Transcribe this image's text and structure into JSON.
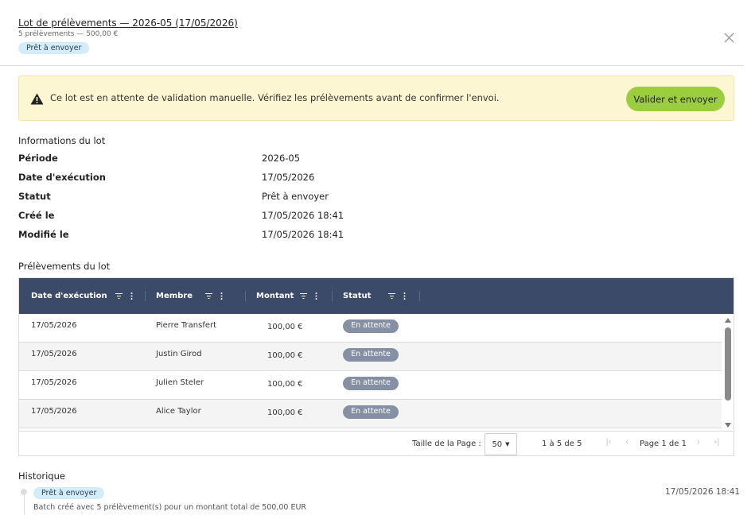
{
  "header": {
    "title": "Lot de prélèvements — 2026-05 (17/05/2026)",
    "subtitle": "5 prélèvements — 500,00 €",
    "status_badge": "Prêt à envoyer",
    "close_icon": "close-icon"
  },
  "alert": {
    "icon": "warning-icon",
    "message": "Ce lot est en attente de validation manuelle. Vérifiez les prélèvements avant de confirmer l'envoi.",
    "action_label": "Valider et envoyer"
  },
  "info": {
    "section_title": "Informations du lot",
    "fields": [
      {
        "label": "Période",
        "value": "2026-05"
      },
      {
        "label": "Date d'exécution",
        "value": "17/05/2026"
      },
      {
        "label": "Statut",
        "value": "Prêt à envoyer"
      },
      {
        "label": "Créé le",
        "value": "17/05/2026 18:41"
      },
      {
        "label": "Modifié le",
        "value": "17/05/2026 18:41"
      }
    ]
  },
  "debits": {
    "section_title": "Prélèvements du lot",
    "columns": [
      "Date d'exécution",
      "Membre",
      "Montant",
      "Statut"
    ],
    "rows": [
      {
        "date": "17/05/2026",
        "member": "Pierre Transfert",
        "amount": "100,00 €",
        "status": "En attente"
      },
      {
        "date": "17/05/2026",
        "member": "Justin Girod",
        "amount": "100,00 €",
        "status": "En attente"
      },
      {
        "date": "17/05/2026",
        "member": "Julien Steler",
        "amount": "100,00 €",
        "status": "En attente"
      },
      {
        "date": "17/05/2026",
        "member": "Alice Taylor",
        "amount": "100,00 €",
        "status": "En attente"
      }
    ],
    "footer": {
      "page_size_label": "Taille de la Page :",
      "page_size": "50",
      "range": "1 à 5 de 5",
      "page_info": "Page 1 de 1"
    }
  },
  "history": {
    "section_title": "Historique",
    "entries": [
      {
        "status": "Prêt à envoyer",
        "timestamp": "17/05/2026 18:41",
        "description": "Batch créé avec 5 prélèvement(s) pour un montant total de 500,00 EUR"
      }
    ]
  },
  "colors": {
    "accent_green": "#9ccd3f",
    "grid_header": "#3b4a69",
    "alert_bg": "#fdf6d3",
    "badge_bg": "#d2ecf9",
    "pill_bg": "#8690a4"
  }
}
